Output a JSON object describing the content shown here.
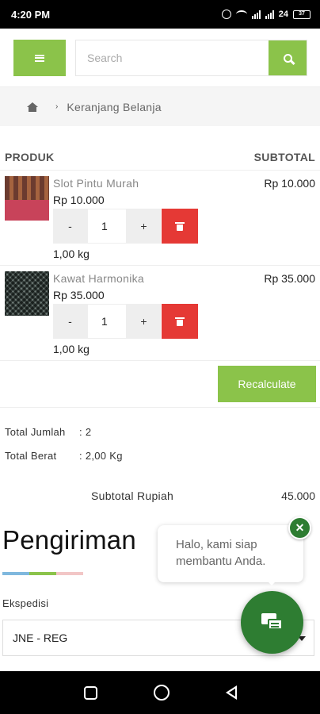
{
  "status_bar": {
    "time": "4:20 PM",
    "battery": "37",
    "network": "24"
  },
  "header": {
    "search_placeholder": "Search"
  },
  "breadcrumb": {
    "current": "Keranjang Belanja"
  },
  "cart": {
    "col_product": "PRODUK",
    "col_subtotal": "SUBTOTAL",
    "items": [
      {
        "name": "Slot Pintu Murah",
        "price": "Rp 10.000",
        "subtotal": "Rp 10.000",
        "qty_minus": "-",
        "qty": "1",
        "qty_plus": "+",
        "weight": "1,00 kg"
      },
      {
        "name": "Kawat Harmonika",
        "price": "Rp 35.000",
        "subtotal": "Rp 35.000",
        "qty_minus": "-",
        "qty": "1",
        "qty_plus": "+",
        "weight": "1,00 kg"
      }
    ],
    "recalculate": "Recalculate",
    "total_jumlah_label": "Total Jumlah",
    "total_jumlah_value": ": 2",
    "total_berat_label": "Total Berat",
    "total_berat_value": ": 2,00 Kg",
    "subtotal_label": "Subtotal Rupiah",
    "subtotal_value": "45.000"
  },
  "shipping": {
    "title": "Pengiriman",
    "ekspedisi_label": "Ekspedisi",
    "ekspedisi_value": "JNE - REG",
    "divider_colors": [
      "#7fb8de",
      "#8bc34a",
      "#f2c6c6"
    ]
  },
  "chat": {
    "message": "Halo, kami siap membantu Anda.",
    "close": "✕"
  },
  "colors": {
    "accent": "#8bc34a",
    "danger": "#e53935",
    "chat": "#2e7d32"
  }
}
